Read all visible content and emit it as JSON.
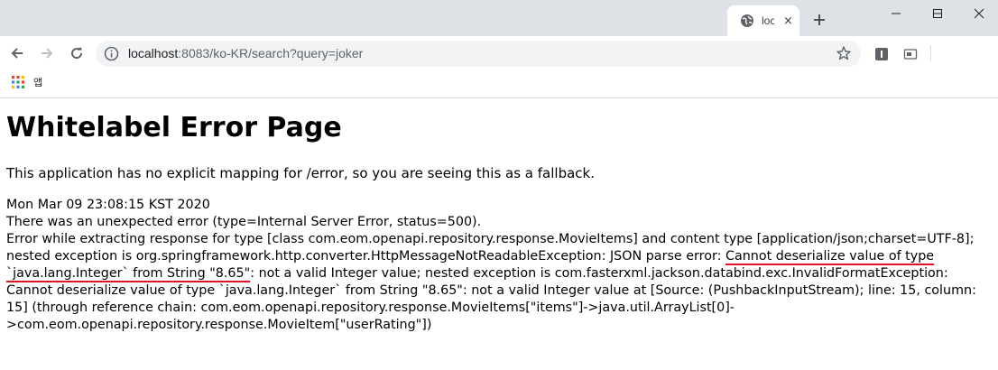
{
  "browser": {
    "tab": {
      "title": "loc",
      "close_glyph": "×",
      "favicon": "globe-icon"
    },
    "new_tab_glyph": "+",
    "window_controls": [
      "minimize-icon",
      "maximize-icon",
      "close-icon"
    ],
    "toolbar": {
      "back_icon": "back-arrow-icon",
      "forward_icon": "forward-arrow-icon",
      "reload_icon": "reload-icon",
      "url_host": "localhost",
      "url_rest": ":8083/ko-KR/search?query=joker",
      "star_icon": "star-icon"
    },
    "bookmarks": {
      "apps_label": "앱"
    }
  },
  "page": {
    "title": "Whitelabel Error Page",
    "fallback": "This application has no explicit mapping for /error, so you are seeing this as a fallback.",
    "timestamp": "Mon Mar 09 23:08:15 KST 2020",
    "status_line": "There was an unexpected error (type=Internal Server Error, status=500).",
    "error_before": "Error while extracting response for type [class com.eom.openapi.repository.response.MovieItems] and content type [application/json;charset=UTF-8]; nested exception is org.springframework.http.converter.HttpMessageNotReadableException: JSON parse error: ",
    "error_highlight": "Cannot deserialize value of type `java.lang.Integer` from String \"8.65\"",
    "error_after": ": not a valid Integer value; nested exception is com.fasterxml.jackson.databind.exc.InvalidFormatException: Cannot deserialize value of type `java.lang.Integer` from String \"8.65\": not a valid Integer value at [Source: (PushbackInputStream); line: 15, column: 15] (through reference chain: com.eom.openapi.repository.response.MovieItems[\"items\"]->java.util.ArrayList[0]->com.eom.openapi.repository.response.MovieItem[\"userRating\"])"
  },
  "colors": {
    "highlight_underline": "#e0112b",
    "tabstrip": "#dee1e6",
    "omnibox": "#f1f3f4"
  }
}
